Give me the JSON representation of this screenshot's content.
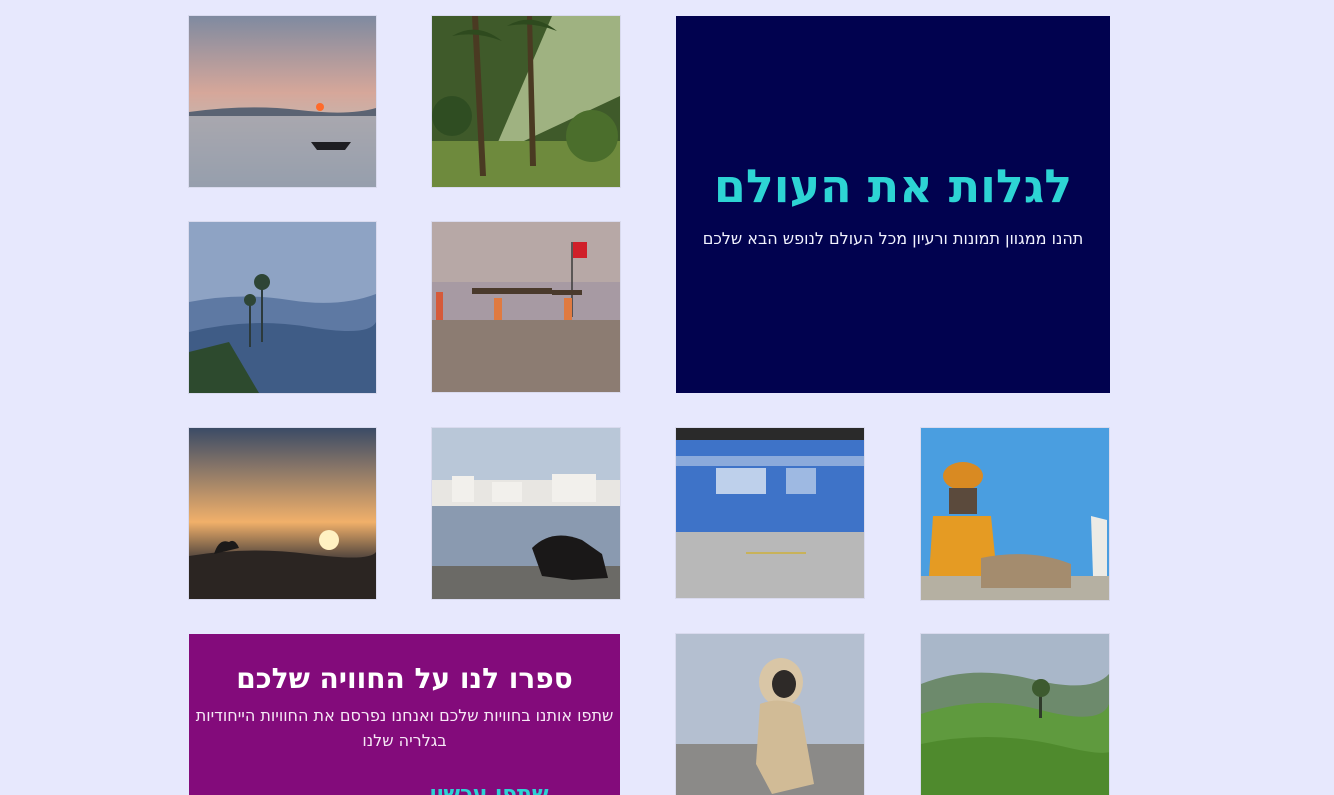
{
  "hero": {
    "title": "לגלות את העולם",
    "subtitle": "תהנו ממגוון תמונות ורעיון מכל העולם לנופש הבא שלכם",
    "background": "#01024f",
    "title_color": "#2dd4d4"
  },
  "story": {
    "title": "ספרו לנו על החוויה שלכם",
    "body": "שתפו אותנו בחוויות שלכם ואנחנו נפרסם את החוויות הייחודיות בגלריה שלנו",
    "cta": "שתפו עכשיו",
    "background": "#830b7b"
  },
  "gallery": [
    {
      "name": "sunset-lake-boat-photo"
    },
    {
      "name": "palm-grove-sunrays-photo"
    },
    {
      "name": "misty-mountains-tree-photo"
    },
    {
      "name": "beach-women-carrying-wood-photo"
    },
    {
      "name": "sunset-mudflats-photo"
    },
    {
      "name": "cow-by-lake-town-photo"
    },
    {
      "name": "blue-train-motion-photo"
    },
    {
      "name": "man-orange-turban-photo"
    },
    {
      "name": "langur-monkey-photo"
    },
    {
      "name": "tea-plantation-hills-photo"
    }
  ],
  "colors": {
    "page_background": "#e7e8fd",
    "accent": "#2dd4d4"
  }
}
